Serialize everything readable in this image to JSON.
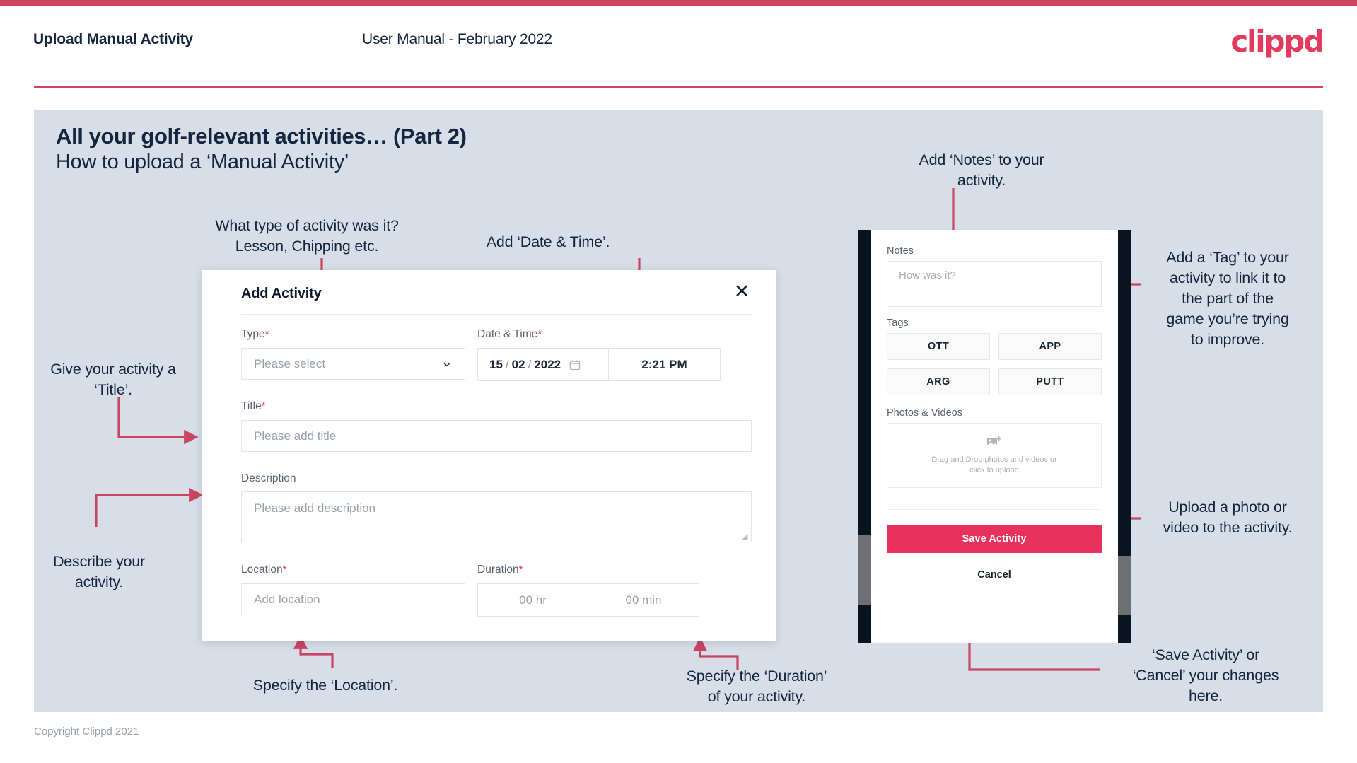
{
  "header": {
    "title": "Upload Manual Activity",
    "subtitle": "User Manual - February 2022",
    "logo": "clippd"
  },
  "slide": {
    "title": "All your golf-relevant activities… (Part 2)",
    "subtitle": "How to upload a ‘Manual Activity’"
  },
  "annotations": {
    "type": "What type of activity was it?\nLesson, Chipping etc.",
    "datetime": "Add ‘Date & Time’.",
    "title": "Give your activity a\n‘Title’.",
    "description": "Describe your\nactivity.",
    "location": "Specify the ‘Location’.",
    "duration": "Specify the ‘Duration’\nof your activity.",
    "notes": "Add ‘Notes’ to your\nactivity.",
    "tags": "Add a ‘Tag’ to your\nactivity to link it to\nthe part of the\ngame you’re trying\nto improve.",
    "photos": "Upload a photo or\nvideo to the activity.",
    "save": "‘Save Activity’ or\n‘Cancel’ your changes\nhere."
  },
  "modal": {
    "title": "Add Activity",
    "close_icon": "close-icon",
    "fields": {
      "type": {
        "label": "Type",
        "required": "*",
        "placeholder": "Please select",
        "icon": "chevron-down-icon"
      },
      "datetime": {
        "label": "Date & Time",
        "required": "*",
        "day": "15",
        "month": "02",
        "year": "2022",
        "sep1": "/",
        "sep2": "/",
        "time": "2:21 PM",
        "icon": "calendar-icon"
      },
      "title": {
        "label": "Title",
        "required": "*",
        "placeholder": "Please add title"
      },
      "description": {
        "label": "Description",
        "required": "",
        "placeholder": "Please add description"
      },
      "location": {
        "label": "Location",
        "required": "*",
        "placeholder": "Add location"
      },
      "duration": {
        "label": "Duration",
        "required": "*",
        "hours": "00 hr",
        "minutes": "00 min"
      }
    }
  },
  "phone": {
    "notes": {
      "label": "Notes",
      "placeholder": "How was it?"
    },
    "tags": {
      "label": "Tags",
      "items": [
        "OTT",
        "APP",
        "ARG",
        "PUTT"
      ]
    },
    "photos": {
      "label": "Photos & Videos",
      "icon": "image-upload-icon",
      "drop_text_line1": "Drag and Drop photos and videos or",
      "drop_text_line2": "click to upload"
    },
    "save_label": "Save Activity",
    "cancel_label": "Cancel"
  },
  "footer": {
    "copyright": "Copyright Clippd 2021"
  },
  "colors": {
    "brand": "#e8315c",
    "accent_bar": "#d0445e",
    "slide_bg": "#d7dee7",
    "ink": "#14253f",
    "arrow": "#c94663"
  }
}
